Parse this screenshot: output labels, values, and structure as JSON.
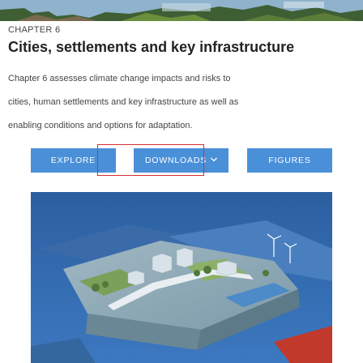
{
  "chapter": {
    "label": "CHAPTER 6"
  },
  "title": "Cities, settlements and key infrastructure",
  "description": {
    "line1": "Chapter 6 assesses climate change impacts and risks to",
    "line2": "cities, human settlements and key infrastructure as well as",
    "line3": "enabling conditions and options for adaptation."
  },
  "buttons": {
    "explore": "EXPLORE",
    "downloads": "DOWNLOADS",
    "figures": "FIGURES"
  },
  "icons": {
    "downloads_chevron": "chevron-down-icon"
  },
  "colors": {
    "button_bg": "#4a90d9",
    "highlight_border": "#d32f2f"
  }
}
